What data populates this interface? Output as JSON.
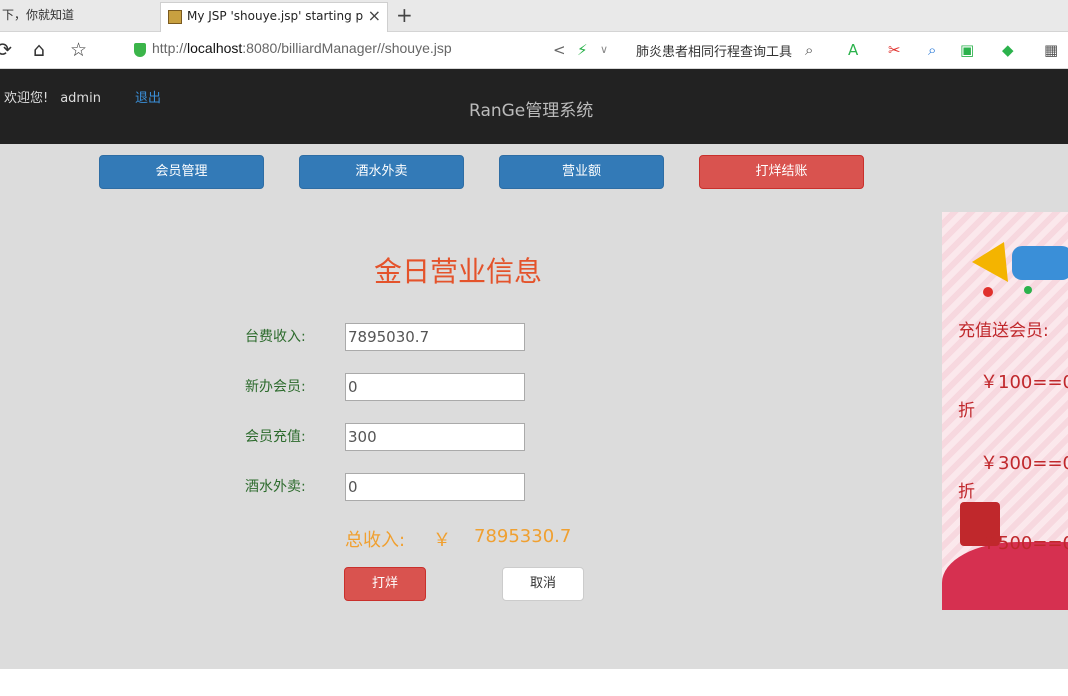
{
  "browser": {
    "tab1_title": "下，你就知道",
    "tab2_title": "My JSP 'shouye.jsp' starting p",
    "tab2_close": "×",
    "new_tab": "+",
    "url_prefix": "http://",
    "url_host": "localhost",
    "url_rest": ":8080/billiardManager//shouye.jsp",
    "search_text": "肺炎患者相同行程查询工具"
  },
  "header": {
    "welcome": "欢迎您!",
    "username": "admin",
    "logout": "退出",
    "brand": "RanGe管理系统"
  },
  "nav": {
    "member": "会员管理",
    "drinks": "酒水外卖",
    "revenue": "营业额",
    "checkout": "打烊结账"
  },
  "main": {
    "title": "金日营业信息",
    "fields": [
      {
        "label": "台费收入:",
        "value": "7895030.7"
      },
      {
        "label": "新办会员:",
        "value": "0"
      },
      {
        "label": "会员充值:",
        "value": "300"
      },
      {
        "label": "酒水外卖:",
        "value": "0"
      }
    ],
    "total_label": "总收入:",
    "total_currency": "￥",
    "total_value": "7895330.7",
    "print_button": "打烊",
    "cancel_button": "取消"
  },
  "promo": {
    "title": "充值送会员:",
    "lines": [
      "￥100==0",
      "￥300==0",
      "￥500==0"
    ],
    "suffix": "折"
  },
  "colors": {
    "accent_blue": "#337ab7",
    "danger_red": "#d9534f",
    "title_orange": "#e4532b",
    "total_orange": "#f0a030",
    "label_green": "#2d6b2d"
  }
}
